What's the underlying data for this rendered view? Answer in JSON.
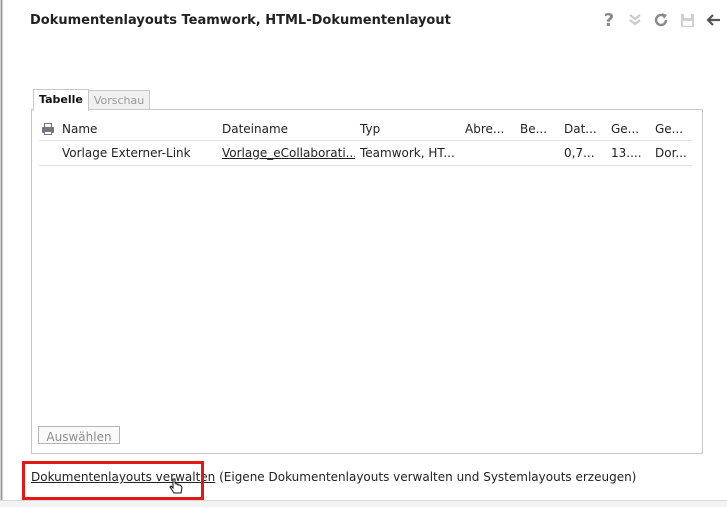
{
  "window": {
    "title": "Dokumentenlayouts Teamwork, HTML-Dokumentenlayout"
  },
  "toolbar": {
    "help_icon": "?",
    "collapse_icon": "»",
    "refresh_icon": "↻",
    "save_icon": "■",
    "back_icon": "←"
  },
  "tabs": [
    {
      "label": "Tabelle",
      "active": true
    },
    {
      "label": "Vorschau",
      "active": false
    }
  ],
  "table": {
    "columns": [
      "Name",
      "Dateiname",
      "Typ",
      "Abre...",
      "Be...",
      "Dat...",
      "Ge...",
      "Ge..."
    ],
    "rows": [
      [
        "Vorlage Externer-Link",
        "Vorlage_eCollaborati...",
        "Teamwork, HT...",
        "",
        "",
        "0,7...",
        "13....",
        "Dor..."
      ]
    ]
  },
  "select_button": {
    "label": "Auswählen"
  },
  "footer": {
    "link": "Dokumentenlayouts verwalten",
    "description": "(Eigene Dokumentenlayouts verwalten und Systemlayouts erzeugen)"
  },
  "colors": {
    "highlight": "#e01818"
  }
}
